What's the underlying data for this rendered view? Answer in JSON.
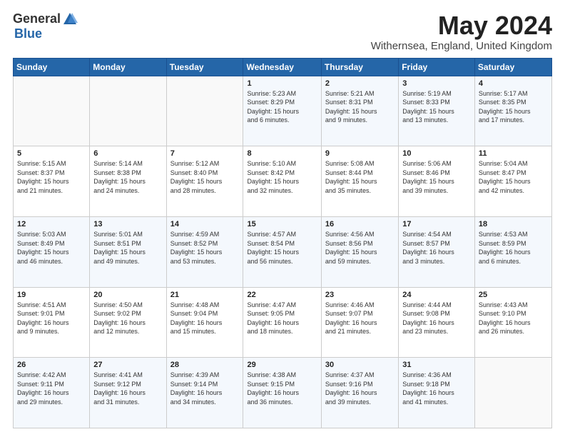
{
  "logo": {
    "general": "General",
    "blue": "Blue"
  },
  "header": {
    "month": "May 2024",
    "location": "Withernsea, England, United Kingdom"
  },
  "days_of_week": [
    "Sunday",
    "Monday",
    "Tuesday",
    "Wednesday",
    "Thursday",
    "Friday",
    "Saturday"
  ],
  "weeks": [
    [
      {
        "day": "",
        "content": ""
      },
      {
        "day": "",
        "content": ""
      },
      {
        "day": "",
        "content": ""
      },
      {
        "day": "1",
        "content": "Sunrise: 5:23 AM\nSunset: 8:29 PM\nDaylight: 15 hours\nand 6 minutes."
      },
      {
        "day": "2",
        "content": "Sunrise: 5:21 AM\nSunset: 8:31 PM\nDaylight: 15 hours\nand 9 minutes."
      },
      {
        "day": "3",
        "content": "Sunrise: 5:19 AM\nSunset: 8:33 PM\nDaylight: 15 hours\nand 13 minutes."
      },
      {
        "day": "4",
        "content": "Sunrise: 5:17 AM\nSunset: 8:35 PM\nDaylight: 15 hours\nand 17 minutes."
      }
    ],
    [
      {
        "day": "5",
        "content": "Sunrise: 5:15 AM\nSunset: 8:37 PM\nDaylight: 15 hours\nand 21 minutes."
      },
      {
        "day": "6",
        "content": "Sunrise: 5:14 AM\nSunset: 8:38 PM\nDaylight: 15 hours\nand 24 minutes."
      },
      {
        "day": "7",
        "content": "Sunrise: 5:12 AM\nSunset: 8:40 PM\nDaylight: 15 hours\nand 28 minutes."
      },
      {
        "day": "8",
        "content": "Sunrise: 5:10 AM\nSunset: 8:42 PM\nDaylight: 15 hours\nand 32 minutes."
      },
      {
        "day": "9",
        "content": "Sunrise: 5:08 AM\nSunset: 8:44 PM\nDaylight: 15 hours\nand 35 minutes."
      },
      {
        "day": "10",
        "content": "Sunrise: 5:06 AM\nSunset: 8:46 PM\nDaylight: 15 hours\nand 39 minutes."
      },
      {
        "day": "11",
        "content": "Sunrise: 5:04 AM\nSunset: 8:47 PM\nDaylight: 15 hours\nand 42 minutes."
      }
    ],
    [
      {
        "day": "12",
        "content": "Sunrise: 5:03 AM\nSunset: 8:49 PM\nDaylight: 15 hours\nand 46 minutes."
      },
      {
        "day": "13",
        "content": "Sunrise: 5:01 AM\nSunset: 8:51 PM\nDaylight: 15 hours\nand 49 minutes."
      },
      {
        "day": "14",
        "content": "Sunrise: 4:59 AM\nSunset: 8:52 PM\nDaylight: 15 hours\nand 53 minutes."
      },
      {
        "day": "15",
        "content": "Sunrise: 4:57 AM\nSunset: 8:54 PM\nDaylight: 15 hours\nand 56 minutes."
      },
      {
        "day": "16",
        "content": "Sunrise: 4:56 AM\nSunset: 8:56 PM\nDaylight: 15 hours\nand 59 minutes."
      },
      {
        "day": "17",
        "content": "Sunrise: 4:54 AM\nSunset: 8:57 PM\nDaylight: 16 hours\nand 3 minutes."
      },
      {
        "day": "18",
        "content": "Sunrise: 4:53 AM\nSunset: 8:59 PM\nDaylight: 16 hours\nand 6 minutes."
      }
    ],
    [
      {
        "day": "19",
        "content": "Sunrise: 4:51 AM\nSunset: 9:01 PM\nDaylight: 16 hours\nand 9 minutes."
      },
      {
        "day": "20",
        "content": "Sunrise: 4:50 AM\nSunset: 9:02 PM\nDaylight: 16 hours\nand 12 minutes."
      },
      {
        "day": "21",
        "content": "Sunrise: 4:48 AM\nSunset: 9:04 PM\nDaylight: 16 hours\nand 15 minutes."
      },
      {
        "day": "22",
        "content": "Sunrise: 4:47 AM\nSunset: 9:05 PM\nDaylight: 16 hours\nand 18 minutes."
      },
      {
        "day": "23",
        "content": "Sunrise: 4:46 AM\nSunset: 9:07 PM\nDaylight: 16 hours\nand 21 minutes."
      },
      {
        "day": "24",
        "content": "Sunrise: 4:44 AM\nSunset: 9:08 PM\nDaylight: 16 hours\nand 23 minutes."
      },
      {
        "day": "25",
        "content": "Sunrise: 4:43 AM\nSunset: 9:10 PM\nDaylight: 16 hours\nand 26 minutes."
      }
    ],
    [
      {
        "day": "26",
        "content": "Sunrise: 4:42 AM\nSunset: 9:11 PM\nDaylight: 16 hours\nand 29 minutes."
      },
      {
        "day": "27",
        "content": "Sunrise: 4:41 AM\nSunset: 9:12 PM\nDaylight: 16 hours\nand 31 minutes."
      },
      {
        "day": "28",
        "content": "Sunrise: 4:39 AM\nSunset: 9:14 PM\nDaylight: 16 hours\nand 34 minutes."
      },
      {
        "day": "29",
        "content": "Sunrise: 4:38 AM\nSunset: 9:15 PM\nDaylight: 16 hours\nand 36 minutes."
      },
      {
        "day": "30",
        "content": "Sunrise: 4:37 AM\nSunset: 9:16 PM\nDaylight: 16 hours\nand 39 minutes."
      },
      {
        "day": "31",
        "content": "Sunrise: 4:36 AM\nSunset: 9:18 PM\nDaylight: 16 hours\nand 41 minutes."
      },
      {
        "day": "",
        "content": ""
      }
    ]
  ]
}
